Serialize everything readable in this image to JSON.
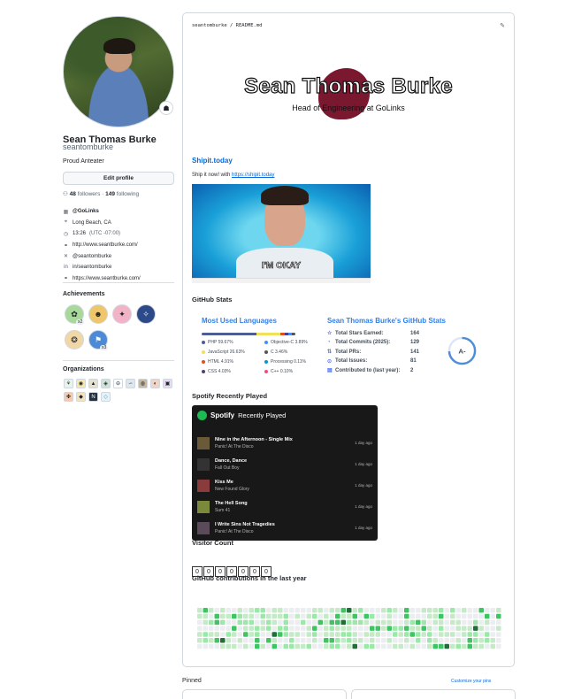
{
  "profile": {
    "name": "Sean Thomas Burke",
    "login": "seantomburke",
    "bio": "Proud Anteater",
    "edit_label": "Edit profile",
    "followers": "48",
    "followers_label": "followers",
    "following": "149",
    "following_label": "following",
    "details": [
      {
        "icon": "org-icon",
        "glyph": "▦",
        "text": "@GoLinks",
        "bold": true
      },
      {
        "icon": "location-icon",
        "glyph": "⌖",
        "text": "Long Beach, CA"
      },
      {
        "icon": "clock-icon",
        "glyph": "◷",
        "text": "13:26",
        "muted": "(UTC -07:00)"
      },
      {
        "icon": "link-icon",
        "glyph": "⚭",
        "text": "http://www.seantburke.com/"
      },
      {
        "icon": "x-icon",
        "glyph": "✕",
        "text": "@seantomburke"
      },
      {
        "icon": "linkedin-icon",
        "glyph": "in",
        "text": "in/seantomburke"
      },
      {
        "icon": "link-icon",
        "glyph": "⚭",
        "text": "https://www.seantburke.com/"
      }
    ]
  },
  "achievements": {
    "title": "Achievements",
    "badge_counts": [
      "x2",
      "x3"
    ]
  },
  "organizations": {
    "title": "Organizations"
  },
  "readme": {
    "path": "seantomburke / README.md",
    "hero_name": "Sean Thomas Burke",
    "hero_sub": "Head of Engineering at GoLinks",
    "shipit_title": "Shipit.today",
    "shipit_text": "Ship it now! with",
    "shipit_link": "https://shipit.today",
    "gif_caption": "I'M OKAY",
    "stats_heading": "GitHub Stats",
    "langs_title": "Most Used Languages",
    "languages": [
      {
        "name": "PHP 59.67%",
        "color": "#4f5d95"
      },
      {
        "name": "Objective-C 3.89%",
        "color": "#438eff"
      },
      {
        "name": "JavaScript 26.63%",
        "color": "#f1e05a"
      },
      {
        "name": "C 3.46%",
        "color": "#555555"
      },
      {
        "name": "HTML 4.91%",
        "color": "#e34c26"
      },
      {
        "name": "Processing 0.11%",
        "color": "#0096d8"
      },
      {
        "name": "CSS 4.03%",
        "color": "#563d7c"
      },
      {
        "name": "C++ 0.10%",
        "color": "#f34b7d"
      }
    ],
    "github_stats_title": "Sean Thomas Burke's GitHub Stats",
    "stats": [
      {
        "icon": "star-icon",
        "glyph": "☆",
        "label": "Total Stars Earned:",
        "value": "164"
      },
      {
        "icon": "history-icon",
        "glyph": "◔",
        "label": "Total Commits (2025):",
        "value": "129"
      },
      {
        "icon": "pr-icon",
        "glyph": "⇅",
        "label": "Total PRs:",
        "value": "141"
      },
      {
        "icon": "issue-icon",
        "glyph": "⊙",
        "label": "Total Issues:",
        "value": "81"
      },
      {
        "icon": "repo-icon",
        "glyph": "▤",
        "label": "Contributed to (last year):",
        "value": "2"
      }
    ],
    "grade": "A-",
    "spotify_heading": "Spotify Recently Played",
    "spotify_brand": "Spotify",
    "spotify_sub": "Recently Played",
    "tracks": [
      {
        "title": "Nine in the Afternoon - Single Mix",
        "artist": "Panic! At The Disco",
        "when": "1 day ago",
        "art": "#6b5a3a"
      },
      {
        "title": "Dance, Dance",
        "artist": "Fall Out Boy",
        "when": "1 day ago",
        "art": "#333333"
      },
      {
        "title": "Kiss Me",
        "artist": "New Found Glory",
        "when": "1 day ago",
        "art": "#8a3b3b"
      },
      {
        "title": "The Hell Song",
        "artist": "Sum 41",
        "when": "1 day ago",
        "art": "#7a8a3a"
      },
      {
        "title": "I Write Sins Not Tragedies",
        "artist": "Panic! At The Disco",
        "when": "1 day ago",
        "art": "#5a4a5a"
      }
    ],
    "visitor_heading": "Visitor Count",
    "visitor_digits": [
      "0",
      "0",
      "0",
      "0",
      "0",
      "0",
      "0"
    ],
    "contrib_heading": "GitHub contributions in the last year"
  },
  "pinned": {
    "title": "Pinned",
    "customize": "Customize your pins"
  }
}
